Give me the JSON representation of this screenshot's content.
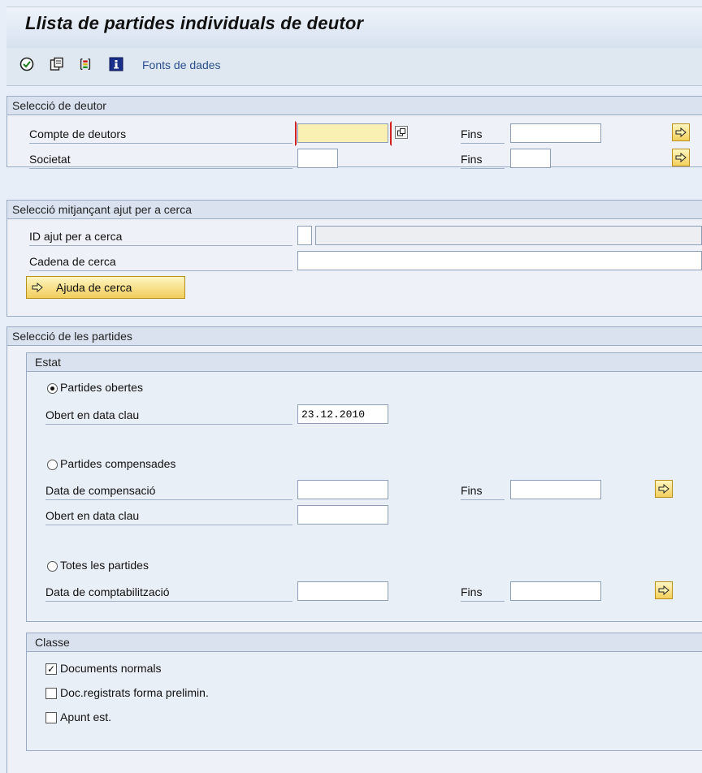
{
  "window": {
    "title": "Llista de partides individuals de deutor"
  },
  "toolbar": {
    "icons": [
      "execute-icon",
      "variant-icon",
      "color-legend-icon",
      "info-icon"
    ],
    "data_sources_link": "Fonts de dades"
  },
  "debtor_selection": {
    "header": "Selecció de deutor",
    "account_label": "Compte de deutors",
    "account_value": "",
    "to_label_1": "Fins",
    "company_label": "Societat",
    "company_value": "",
    "to_label_2": "Fins"
  },
  "search_help": {
    "header": "Selecció mitjançant ajut per a cerca",
    "id_label": "ID ajut per a cerca",
    "string_label": "Cadena de cerca",
    "button_label": "Ajuda de cerca"
  },
  "items_selection": {
    "header": "Selecció de les partides",
    "status": {
      "header": "Estat",
      "open_items_label": "Partides obertes",
      "open_at_key_date_label": "Obert en data clau",
      "open_at_key_date_value": "23.12.2010",
      "cleared_items_label": "Partides compensades",
      "clearing_date_label": "Data de compensació",
      "clearing_to_label": "Fins",
      "cleared_open_key_label": "Obert en data clau",
      "all_items_label": "Totes les partides",
      "posting_date_label": "Data de comptabilització",
      "posting_to_label": "Fins"
    },
    "type": {
      "header": "Classe",
      "normal_docs_label": "Documents normals",
      "normal_docs_checked": true,
      "parked_docs_label": "Doc.registrats forma prelimin.",
      "parked_docs_checked": false,
      "noted_items_label": "Apunt est.",
      "noted_items_checked": false
    }
  },
  "colors": {
    "accent": "#f1cd5b",
    "background": "#e7eef7",
    "link": "#2a4f8c"
  }
}
